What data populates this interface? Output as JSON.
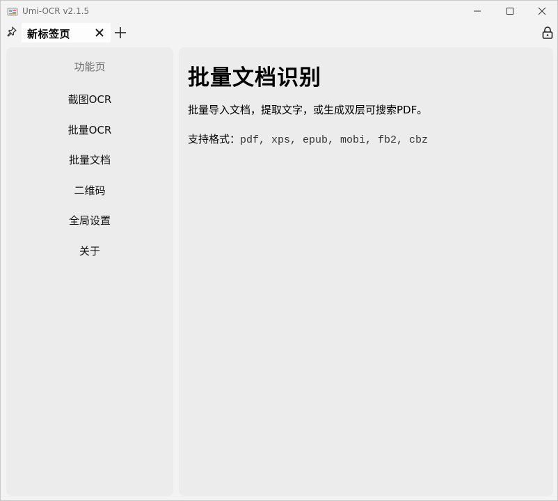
{
  "window": {
    "title": "Umi-OCR v2.1.5",
    "icons": {
      "app": "app-logo-icon",
      "minimize": "minimize-icon",
      "maximize": "maximize-icon",
      "close": "close-icon"
    }
  },
  "tabbar": {
    "tabs": [
      {
        "label": "新标签页",
        "active": true
      }
    ],
    "icons": {
      "pin": "pin-icon",
      "close_tab": "close-tab-icon",
      "add_tab": "plus-icon",
      "lock": "lock-icon"
    }
  },
  "sidebar": {
    "header": "功能页",
    "items": [
      {
        "label": "截图OCR"
      },
      {
        "label": "批量OCR"
      },
      {
        "label": "批量文档"
      },
      {
        "label": "二维码"
      },
      {
        "label": "全局设置"
      },
      {
        "label": "关于"
      }
    ]
  },
  "main": {
    "title": "批量文档识别",
    "description": "批量导入文档，提取文字，或生成双层可搜索PDF。",
    "formats_label": "支持格式：",
    "formats_value": "pdf, xps, epub, mobi, fb2, cbz"
  },
  "colors": {
    "window_bg": "#f3f3f3",
    "panel_bg": "#ececec",
    "active_tab_bg": "#fdfdfd",
    "muted_text": "#6f6f6f"
  }
}
